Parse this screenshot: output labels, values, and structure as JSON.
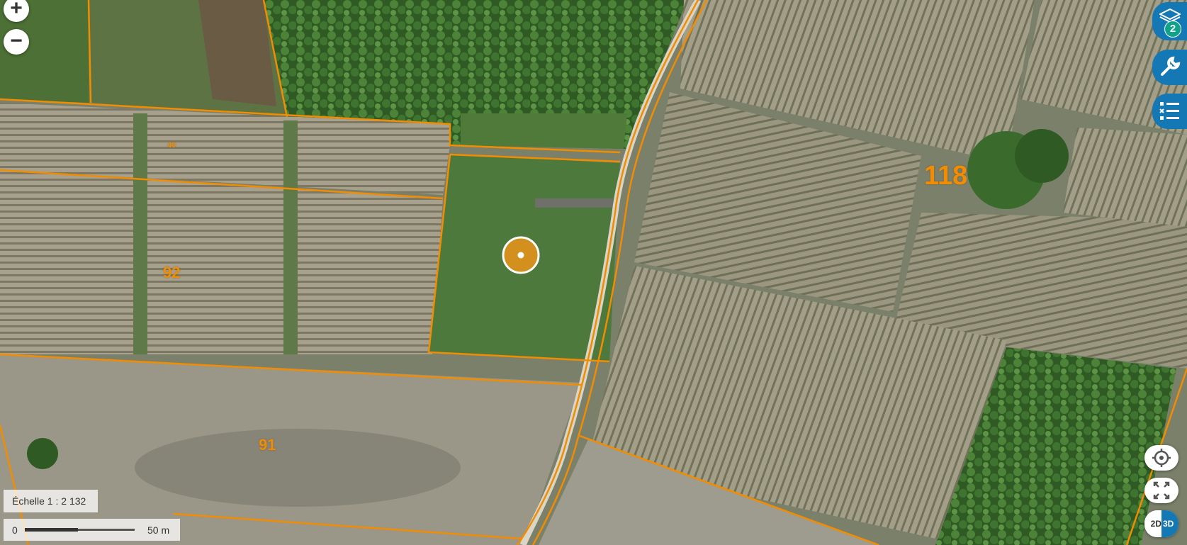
{
  "map": {
    "scale_label": "Échelle 1 : 2 132",
    "scale_bar": {
      "start": "0",
      "end": "50 m"
    },
    "parcels": [
      {
        "number": "118"
      },
      {
        "number": "92"
      },
      {
        "number": "91"
      },
      {
        "number": "40"
      }
    ],
    "layers_badge": "2",
    "mode_2d": "2D",
    "mode_3d": "3D",
    "colors": {
      "parcel_outline": "#f28c00",
      "panel_accent": "#1478b4",
      "badge": "#11a38a",
      "marker": "#d4901e"
    },
    "icons": {
      "zoom_in": "plus-icon",
      "zoom_out": "minus-icon",
      "layers": "layers-icon",
      "tools": "wrench-icon",
      "legend": "list-icon",
      "locate": "crosshair-icon",
      "fullscreen": "expand-icon"
    }
  }
}
